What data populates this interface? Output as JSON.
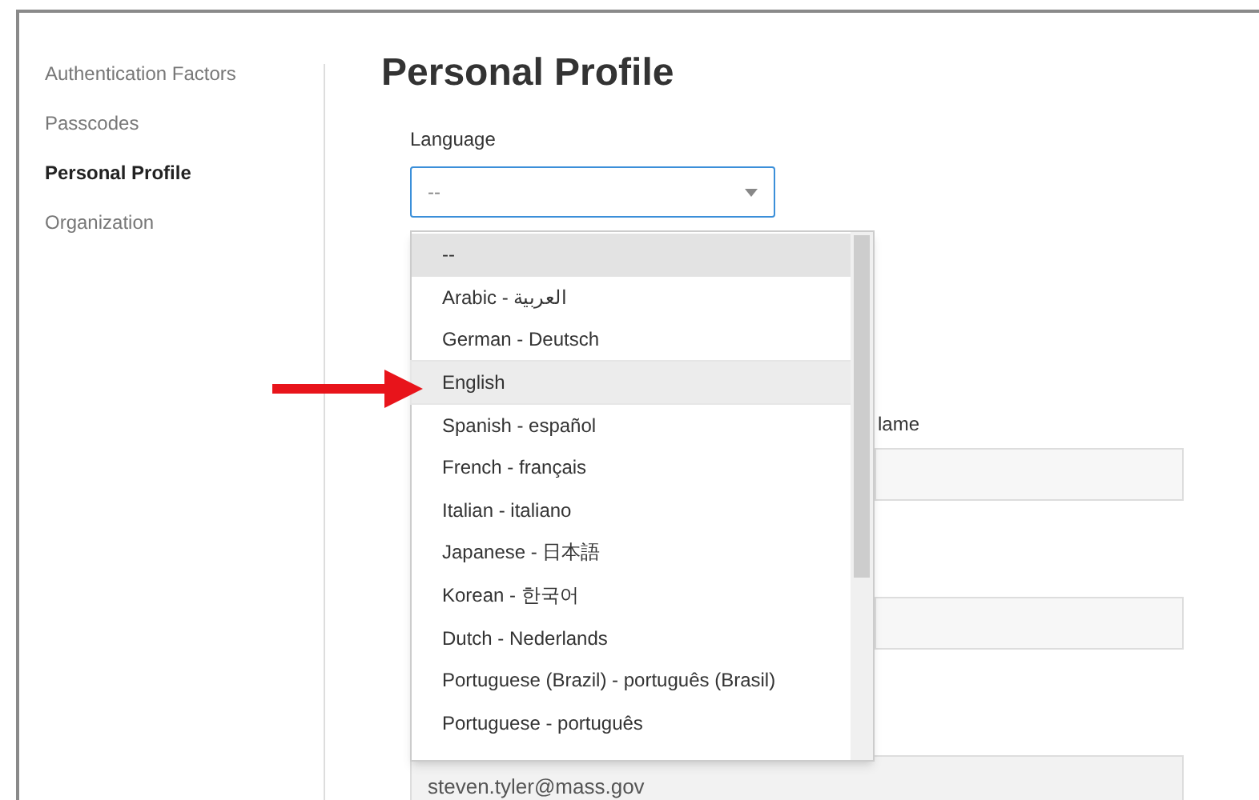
{
  "sidebar": {
    "items": [
      {
        "label": "Authentication Factors",
        "selected": false
      },
      {
        "label": "Passcodes",
        "selected": false
      },
      {
        "label": "Personal Profile",
        "selected": true
      },
      {
        "label": "Organization",
        "selected": false
      }
    ]
  },
  "page_title": "Personal Profile",
  "language": {
    "label": "Language",
    "value": "--",
    "expanded": true,
    "options": [
      {
        "label": "--",
        "selected": true,
        "hovered": false
      },
      {
        "label": "Arabic - العربية",
        "selected": false,
        "hovered": false
      },
      {
        "label": "German - Deutsch",
        "selected": false,
        "hovered": false
      },
      {
        "label": "English",
        "selected": false,
        "hovered": true
      },
      {
        "label": "Spanish - español",
        "selected": false,
        "hovered": false
      },
      {
        "label": "French - français",
        "selected": false,
        "hovered": false
      },
      {
        "label": "Italian - italiano",
        "selected": false,
        "hovered": false
      },
      {
        "label": "Japanese - 日本語",
        "selected": false,
        "hovered": false
      },
      {
        "label": "Korean - 한국어",
        "selected": false,
        "hovered": false
      },
      {
        "label": "Dutch - Nederlands",
        "selected": false,
        "hovered": false
      },
      {
        "label": "Portuguese (Brazil) - português (Brasil)",
        "selected": false,
        "hovered": false
      },
      {
        "label": "Portuguese - português",
        "selected": false,
        "hovered": false
      }
    ]
  },
  "name_field": {
    "label": "lame"
  },
  "email_field": {
    "value": "steven.tyler@mass.gov"
  }
}
